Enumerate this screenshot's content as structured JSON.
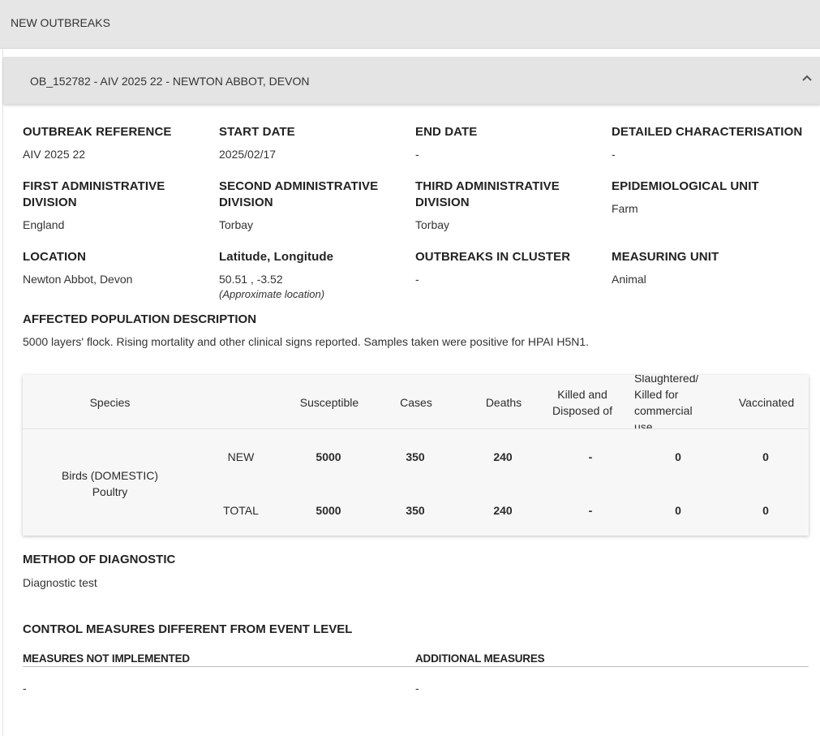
{
  "section_title": "NEW OUTBREAKS",
  "outbreak": {
    "header": "OB_152782 - AIV 2025 22 - NEWTON ABBOT, DEVON",
    "fields": {
      "outbreak_reference": {
        "label": "OUTBREAK REFERENCE",
        "value": "AIV 2025 22"
      },
      "start_date": {
        "label": "START DATE",
        "value": "2025/02/17"
      },
      "end_date": {
        "label": "END DATE",
        "value": "-"
      },
      "detailed_characterisation": {
        "label": "DETAILED CHARACTERISATION",
        "value": "-"
      },
      "first_admin_division": {
        "label": "FIRST ADMINISTRATIVE DIVISION",
        "value": "England"
      },
      "second_admin_division": {
        "label": "SECOND ADMINISTRATIVE DIVISION",
        "value": "Torbay"
      },
      "third_admin_division": {
        "label": "THIRD ADMINISTRATIVE DIVISION",
        "value": "Torbay"
      },
      "epidemiological_unit": {
        "label": "EPIDEMIOLOGICAL UNIT",
        "value": "Farm"
      },
      "location": {
        "label": "LOCATION",
        "value": "Newton Abbot, Devon"
      },
      "lat_long": {
        "label": "Latitude, Longitude",
        "value": "50.51 , -3.52",
        "note": "(Approximate location)"
      },
      "outbreaks_in_cluster": {
        "label": "OUTBREAKS IN CLUSTER",
        "value": "-"
      },
      "measuring_unit": {
        "label": "MEASURING UNIT",
        "value": "Animal"
      }
    },
    "affected_population": {
      "label": "AFFECTED POPULATION DESCRIPTION",
      "value": "5000 layers' flock. Rising mortality and other clinical signs reported. Samples taken were positive for HPAI H5N1."
    },
    "table": {
      "headers": {
        "species": "Species",
        "susceptible": "Susceptible",
        "cases": "Cases",
        "deaths": "Deaths",
        "killed_disposed": "Killed and Disposed of",
        "slaughtered": "Slaughtered/ Killed for commercial use",
        "vaccinated": "Vaccinated"
      },
      "species_name": "Birds (DOMESTIC) Poultry",
      "rows": [
        {
          "type": "NEW",
          "susceptible": "5000",
          "cases": "350",
          "deaths": "240",
          "killed_disposed": "-",
          "slaughtered": "0",
          "vaccinated": "0"
        },
        {
          "type": "TOTAL",
          "susceptible": "5000",
          "cases": "350",
          "deaths": "240",
          "killed_disposed": "-",
          "slaughtered": "0",
          "vaccinated": "0"
        }
      ]
    },
    "method_of_diagnostic": {
      "label": "METHOD OF DIAGNOSTIC",
      "value": "Diagnostic test"
    },
    "control_measures": {
      "label": "CONTROL MEASURES DIFFERENT FROM EVENT LEVEL",
      "not_implemented": {
        "label": "MEASURES NOT IMPLEMENTED",
        "value": "-"
      },
      "additional": {
        "label": "ADDITIONAL MEASURES",
        "value": "-"
      }
    }
  },
  "icons": {
    "collapse": "chevron-up-icon"
  },
  "colors": {
    "header_bg": "#e6e6e6",
    "table_bg": "#f7f7f7"
  }
}
